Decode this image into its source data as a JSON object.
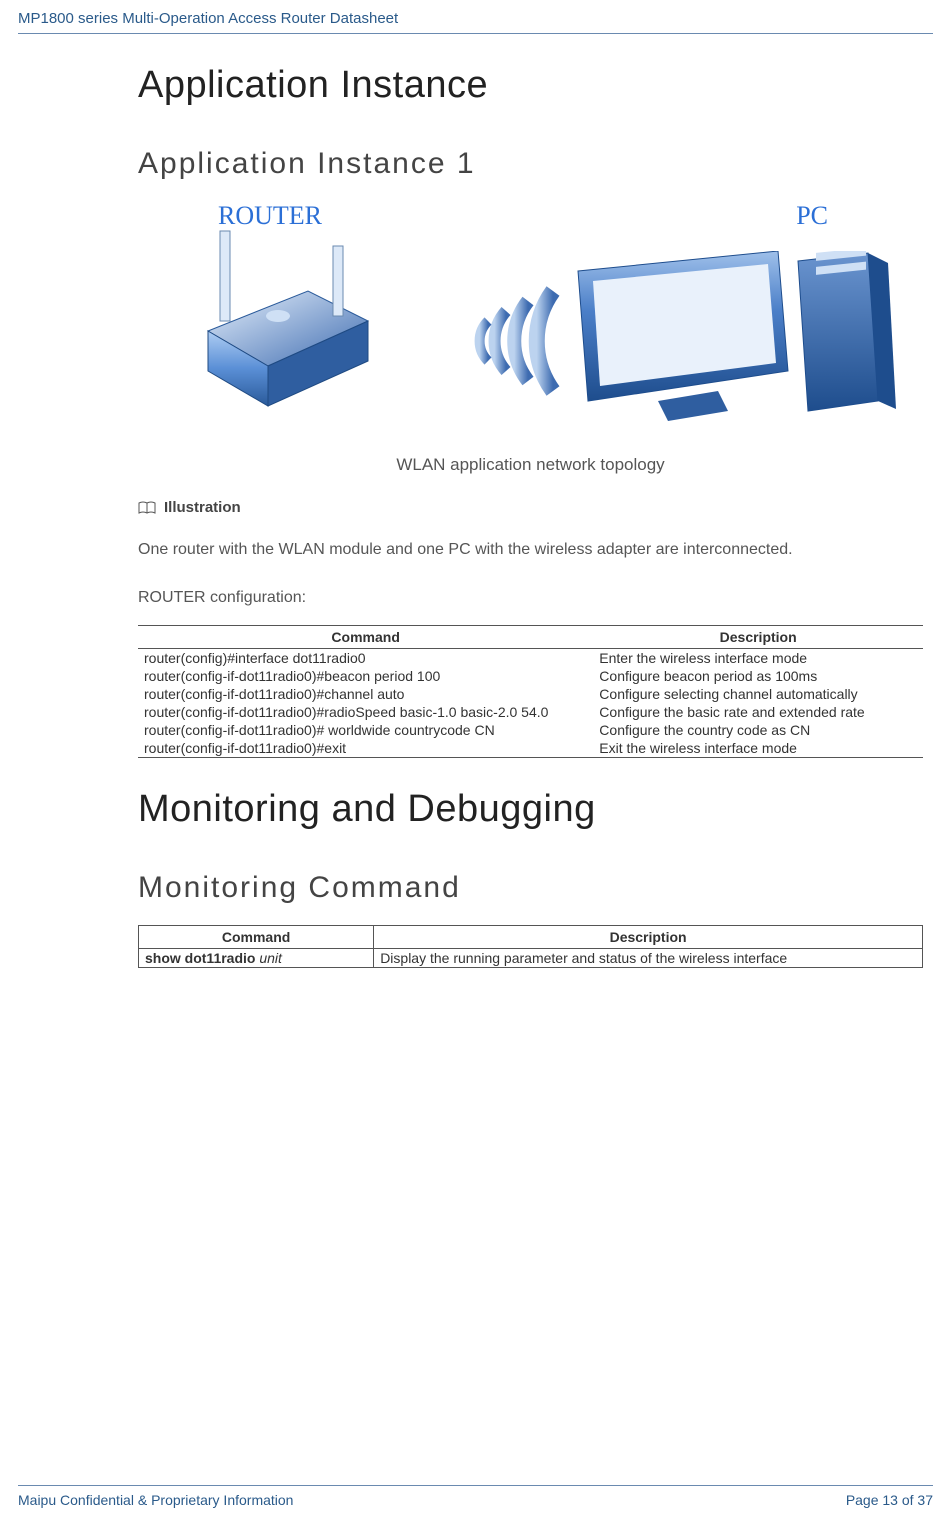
{
  "header": {
    "title": "MP1800 series Multi-Operation Access Router Datasheet"
  },
  "section1": "Application Instance",
  "subsection1": "Application Instance 1",
  "diagram": {
    "router_label": "ROUTER",
    "pc_label": "PC"
  },
  "caption1": "WLAN application network topology",
  "illustration_label": "Illustration",
  "para1": "One router with the WLAN module and one PC with the wireless adapter are interconnected.",
  "para2": "ROUTER configuration:",
  "table1": {
    "headers": [
      "Command",
      "Description"
    ],
    "rows": [
      {
        "cmd": "router(config)#interface dot11radio0",
        "desc": "Enter the wireless interface mode"
      },
      {
        "cmd": "router(config-if-dot11radio0)#beacon period 100",
        "desc": "Configure beacon period as 100ms"
      },
      {
        "cmd": "router(config-if-dot11radio0)#channel auto",
        "desc": "Configure selecting channel automatically"
      },
      {
        "cmd": "router(config-if-dot11radio0)#radioSpeed basic-1.0 basic-2.0 54.0",
        "desc": "Configure the basic rate and extended rate"
      },
      {
        "cmd": "router(config-if-dot11radio0)# worldwide countrycode CN",
        "desc": "Configure the country code as CN"
      },
      {
        "cmd": "router(config-if-dot11radio0)#exit",
        "desc": "Exit the wireless interface mode"
      }
    ]
  },
  "section2": "Monitoring and Debugging",
  "subsection2": "Monitoring Command",
  "table2": {
    "headers": [
      "Command",
      "Description"
    ],
    "rows": [
      {
        "cmd_bold": "show dot11radio ",
        "cmd_ital": "unit",
        "desc": "Display the running parameter and status of the wireless interface"
      }
    ]
  },
  "footer": {
    "left": "Maipu Confidential & Proprietary Information",
    "right": "Page 13 of 37"
  }
}
